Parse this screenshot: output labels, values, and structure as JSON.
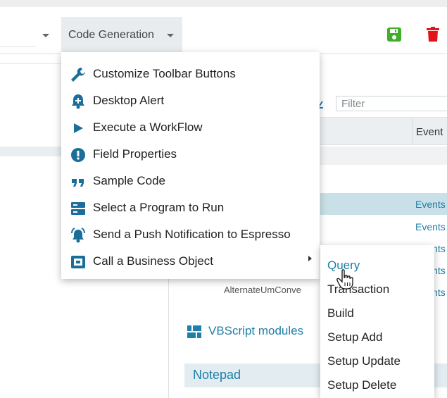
{
  "toolbar": {
    "code_generation_label": "Code Generation",
    "save_icon": "save-icon",
    "delete_icon": "trash-icon",
    "colors": {
      "save": "#3fae29",
      "delete": "#e1141b"
    }
  },
  "background": {
    "filter_placeholder": "Filter",
    "grid_column_label": "Event",
    "events_links": [
      "Events",
      "Events",
      "Events",
      "Events",
      "Events"
    ],
    "alternate_text": "AlternateUmConve",
    "vbscript_label": "VBScript modules",
    "notepad_label": "Notepad"
  },
  "menu": {
    "items": [
      {
        "label": "Customize Toolbar Buttons",
        "icon": "wrench-icon"
      },
      {
        "label": "Desktop Alert",
        "icon": "bell-plus-icon"
      },
      {
        "label": "Execute a WorkFlow",
        "icon": "play-icon"
      },
      {
        "label": "Field Properties",
        "icon": "exclamation-circle-icon"
      },
      {
        "label": "Sample Code",
        "icon": "quote-icon"
      },
      {
        "label": "Select a Program to Run",
        "icon": "server-icon"
      },
      {
        "label": "Send a Push Notification to Espresso",
        "icon": "bell-ring-icon"
      },
      {
        "label": "Call a Business Object",
        "icon": "business-object-icon"
      }
    ]
  },
  "submenu": {
    "items": [
      "Query",
      "Transaction",
      "Build",
      "Setup Add",
      "Setup Update",
      "Setup Delete"
    ]
  },
  "colors": {
    "accent": "#1e7fa8",
    "icon": "#1b6e9a"
  }
}
